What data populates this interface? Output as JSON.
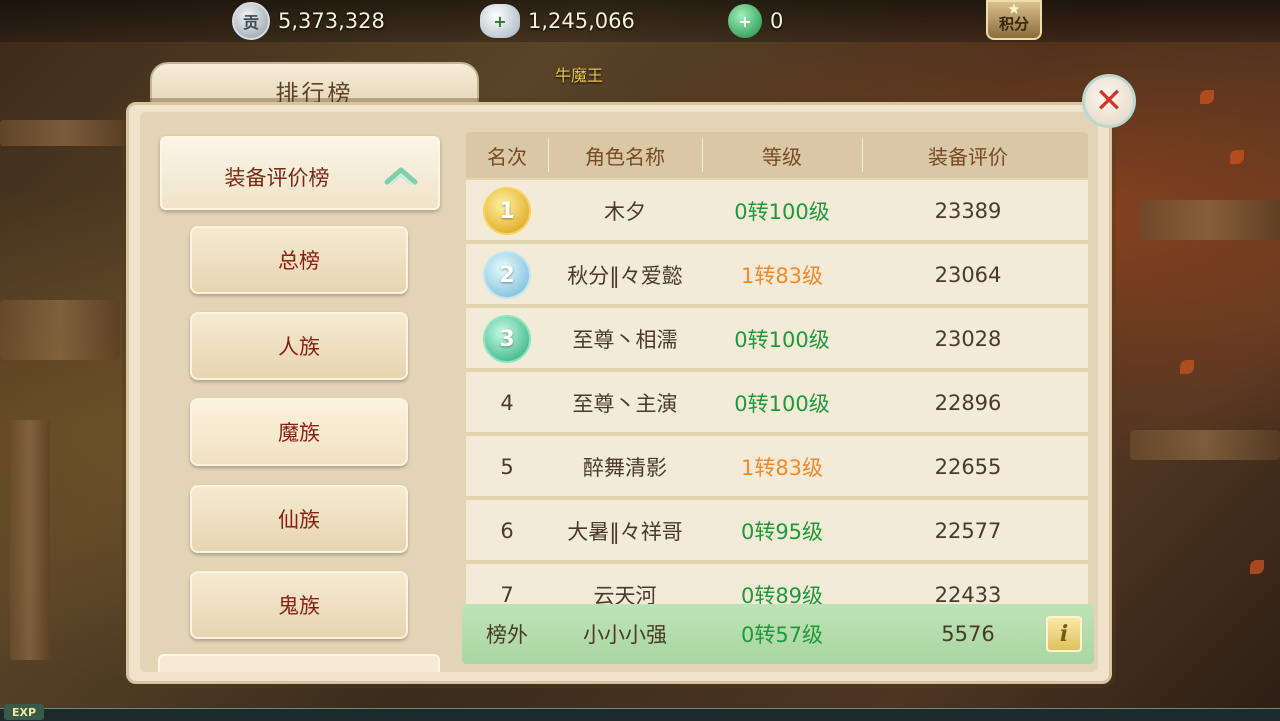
{
  "resources": {
    "contribution": {
      "icon": "贡",
      "value": "5,373,328"
    },
    "silver": {
      "icon": "+",
      "value": "1,245,066"
    },
    "jade": {
      "icon": "+",
      "value": "0"
    },
    "points_label": "积分"
  },
  "npc_name": "牛魔王",
  "panel": {
    "title": "排行榜",
    "close": "✕"
  },
  "categories": {
    "header": "装备评价榜",
    "items": [
      {
        "label": "总榜"
      },
      {
        "label": "人族"
      },
      {
        "label": "魔族"
      },
      {
        "label": "仙族"
      },
      {
        "label": "鬼族"
      }
    ]
  },
  "table": {
    "columns": [
      "名次",
      "角色名称",
      "等级",
      "装备评价"
    ],
    "rows": [
      {
        "rank": "1",
        "name": "木夕",
        "level": "0转100级",
        "level_color": "green",
        "score": "23389"
      },
      {
        "rank": "2",
        "name": "秋分‖々爱懿",
        "level": "1转83级",
        "level_color": "orange",
        "score": "23064"
      },
      {
        "rank": "3",
        "name": "至尊丶相濡",
        "level": "0转100级",
        "level_color": "green",
        "score": "23028"
      },
      {
        "rank": "4",
        "name": "至尊丶主演",
        "level": "0转100级",
        "level_color": "green",
        "score": "22896"
      },
      {
        "rank": "5",
        "name": "醉舞清影",
        "level": "1转83级",
        "level_color": "orange",
        "score": "22655"
      },
      {
        "rank": "6",
        "name": "大暑‖々祥哥",
        "level": "0转95级",
        "level_color": "green",
        "score": "22577"
      },
      {
        "rank": "7",
        "name": "云天河",
        "level": "0转89级",
        "level_color": "green",
        "score": "22433"
      }
    ]
  },
  "my_rank": {
    "rank": "榜外",
    "name": "小小小强",
    "level": "0转57级",
    "score": "5576",
    "info": "i"
  },
  "exp_label": "EXP",
  "colors": {
    "green": "#1e9a3a",
    "orange": "#f08a2a",
    "title_red": "#8a1e10"
  }
}
